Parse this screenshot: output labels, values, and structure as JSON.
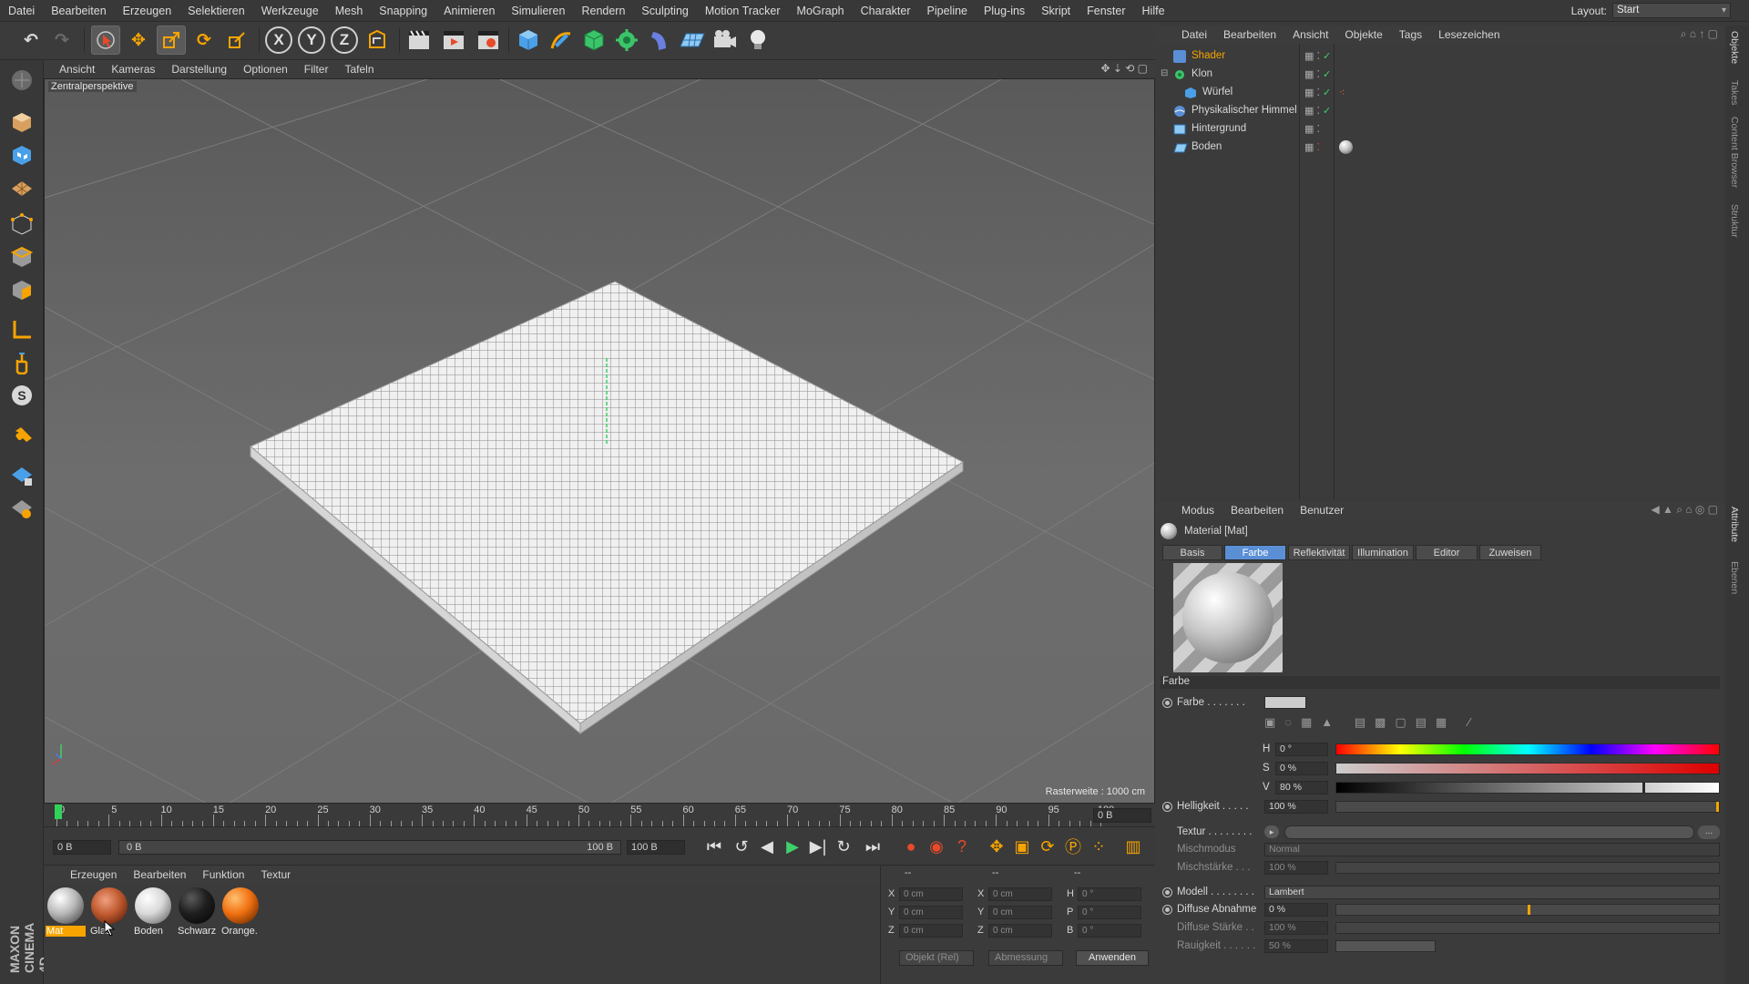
{
  "menubar": {
    "items": [
      "Datei",
      "Bearbeiten",
      "Erzeugen",
      "Selektieren",
      "Werkzeuge",
      "Mesh",
      "Snapping",
      "Animieren",
      "Simulieren",
      "Rendern",
      "Sculpting",
      "Motion Tracker",
      "MoGraph",
      "Charakter",
      "Pipeline",
      "Plug-ins",
      "Skript",
      "Fenster",
      "Hilfe"
    ],
    "layout_label": "Layout:",
    "layout_value": "Start"
  },
  "toolbar": {
    "axis_x": "X",
    "axis_y": "Y",
    "axis_z": "Z"
  },
  "viewport": {
    "menu": [
      "Ansicht",
      "Kameras",
      "Darstellung",
      "Optionen",
      "Filter",
      "Tafeln"
    ],
    "camera_label": "Zentralperspektive",
    "grid_label": "Rasterweite : 1000 cm"
  },
  "timeline": {
    "ticks": [
      "0",
      "5",
      "10",
      "15",
      "20",
      "25",
      "30",
      "35",
      "40",
      "45",
      "50",
      "55",
      "60",
      "65",
      "70",
      "75",
      "80",
      "85",
      "90",
      "95",
      "100"
    ],
    "current_frame": "0 B",
    "start_field": "0 B",
    "range_start": "0 B",
    "range_end": "100 B",
    "end_field": "100 B"
  },
  "material_manager": {
    "menu": [
      "Erzeugen",
      "Bearbeiten",
      "Funktion",
      "Textur"
    ],
    "materials": [
      {
        "name": "Mat",
        "active": true
      },
      {
        "name": "Glas",
        "active": false
      },
      {
        "name": "Boden",
        "active": false
      },
      {
        "name": "Schwarz",
        "active": false
      },
      {
        "name": "Orange.",
        "active": false
      }
    ]
  },
  "coordinates": {
    "header": "--",
    "header2": "--",
    "header3": "--",
    "rows": [
      {
        "a": "X",
        "av": "0 cm",
        "b": "X",
        "bv": "0 cm",
        "c": "H",
        "cv": "0 °"
      },
      {
        "a": "Y",
        "av": "0 cm",
        "b": "Y",
        "bv": "0 cm",
        "c": "P",
        "cv": "0 °"
      },
      {
        "a": "Z",
        "av": "0 cm",
        "b": "Z",
        "bv": "0 cm",
        "c": "B",
        "cv": "0 °"
      }
    ],
    "mode_select": "Objekt (Rel)",
    "size_select": "Abmessung",
    "apply_button": "Anwenden"
  },
  "object_manager": {
    "menu": [
      "Datei",
      "Bearbeiten",
      "Ansicht",
      "Objekte",
      "Tags",
      "Lesezeichen"
    ],
    "objects": [
      {
        "name": "Shader",
        "level": 0,
        "highlight": true
      },
      {
        "name": "Klon",
        "level": 0,
        "highlight": false
      },
      {
        "name": "Würfel",
        "level": 1,
        "highlight": false
      },
      {
        "name": "Physikalischer Himmel",
        "level": 0,
        "highlight": false
      },
      {
        "name": "Hintergrund",
        "level": 0,
        "highlight": false
      },
      {
        "name": "Boden",
        "level": 0,
        "highlight": false
      }
    ]
  },
  "right_tabs": [
    "Objekte",
    "Takes",
    "Content Browser",
    "Struktur",
    "Attribute",
    "Ebenen"
  ],
  "attribute_manager": {
    "menu": [
      "Modus",
      "Bearbeiten",
      "Benutzer"
    ],
    "title": "Material [Mat]",
    "tabs": [
      "Basis",
      "Farbe",
      "Reflektivität",
      "Illumination",
      "Editor",
      "Zuweisen"
    ],
    "active_tab": "Farbe",
    "section": "Farbe",
    "color_label": "Farbe . . . . . . .",
    "hsv": [
      {
        "label": "H",
        "value": "0 °"
      },
      {
        "label": "S",
        "value": "0 %"
      },
      {
        "label": "V",
        "value": "80 %"
      }
    ],
    "v_level": 0.8,
    "brightness_label": "Helligkeit . . . . .",
    "brightness_value": "100 %",
    "texture_label": "Textur . . . . . . . .",
    "texture_button": "...",
    "mixmode_label": "Mischmodus",
    "mixmode_value": "Normal",
    "mixstrength_label": "Mischstärke . . .",
    "mixstrength_value": "100 %",
    "model_label": "Modell . . . . . . . .",
    "model_value": "Lambert",
    "diffuse_falloff_label": "Diffuse Abnahme",
    "diffuse_falloff_value": "0 %",
    "diffuse_strength_label": "Diffuse Stärke . .",
    "diffuse_strength_value": "100 %",
    "roughness_label": "Rauigkeit . . . . . .",
    "roughness_value": "50 %",
    "colors": {
      "accent": "#5a8fd6",
      "selection": "#f7a400",
      "playhead": "#2fd35a"
    }
  }
}
